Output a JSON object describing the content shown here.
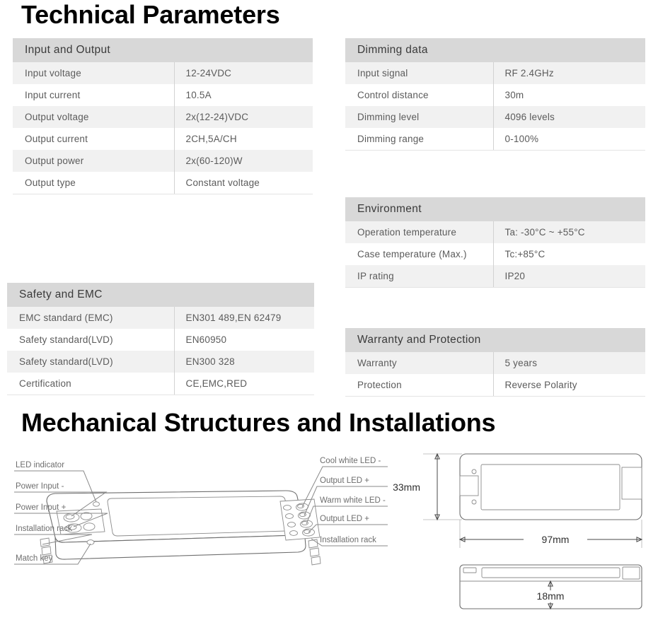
{
  "headings": {
    "technical": "Technical Parameters",
    "mechanical": "Mechanical Structures and Installations"
  },
  "tables": {
    "input_output": {
      "title": "Input and Output",
      "rows": [
        {
          "label": "Input voltage",
          "value": "12-24VDC"
        },
        {
          "label": "Input current",
          "value": "10.5A"
        },
        {
          "label": "Output voltage",
          "value": "2x(12-24)VDC"
        },
        {
          "label": "Output current",
          "value": "2CH,5A/CH"
        },
        {
          "label": "Output power",
          "value": "2x(60-120)W"
        },
        {
          "label": "Output type",
          "value": "Constant voltage"
        }
      ]
    },
    "safety_emc": {
      "title": "Safety and EMC",
      "rows": [
        {
          "label": "EMC standard (EMC)",
          "value": "EN301 489,EN 62479"
        },
        {
          "label": "Safety standard(LVD)",
          "value": "EN60950"
        },
        {
          "label": "Safety standard(LVD)",
          "value": "EN300 328"
        },
        {
          "label": "Certification",
          "value": "CE,EMC,RED"
        }
      ]
    },
    "dimming_data": {
      "title": "Dimming data",
      "rows": [
        {
          "label": "Input signal",
          "value": "RF 2.4GHz"
        },
        {
          "label": "Control distance",
          "value": "30m"
        },
        {
          "label": "Dimming level",
          "value": "4096 levels"
        },
        {
          "label": "Dimming range",
          "value": "0-100%"
        }
      ]
    },
    "environment": {
      "title": "Environment",
      "rows": [
        {
          "label": "Operation temperature",
          "value": "Ta: -30°C ~ +55°C"
        },
        {
          "label": "Case temperature (Max.)",
          "value": "Tc:+85°C"
        },
        {
          "label": "IP rating",
          "value": "IP20"
        }
      ]
    },
    "warranty": {
      "title": "Warranty and Protection",
      "rows": [
        {
          "label": "Warranty",
          "value": "5 years"
        },
        {
          "label": "Protection",
          "value": "Reverse Polarity"
        }
      ]
    }
  },
  "mechanical": {
    "callouts_left": [
      "LED indicator",
      "Power Input -",
      "Power Input +",
      "Installation rack",
      "Match key"
    ],
    "callouts_right": [
      "Cool white LED -",
      "Output LED +",
      "Warm white LED -",
      "Output LED +",
      "Installation rack"
    ],
    "dimensions": {
      "height": "33mm",
      "length": "97mm",
      "thickness": "18mm"
    }
  },
  "colors": {
    "table_header_bg": "#d8d8d8",
    "row_odd_bg": "#f1f1f1",
    "row_even_bg": "#ffffff",
    "label_text": "#5b5b5b",
    "heading_text": "#000000",
    "drawing_line": "#6f6f6f"
  }
}
